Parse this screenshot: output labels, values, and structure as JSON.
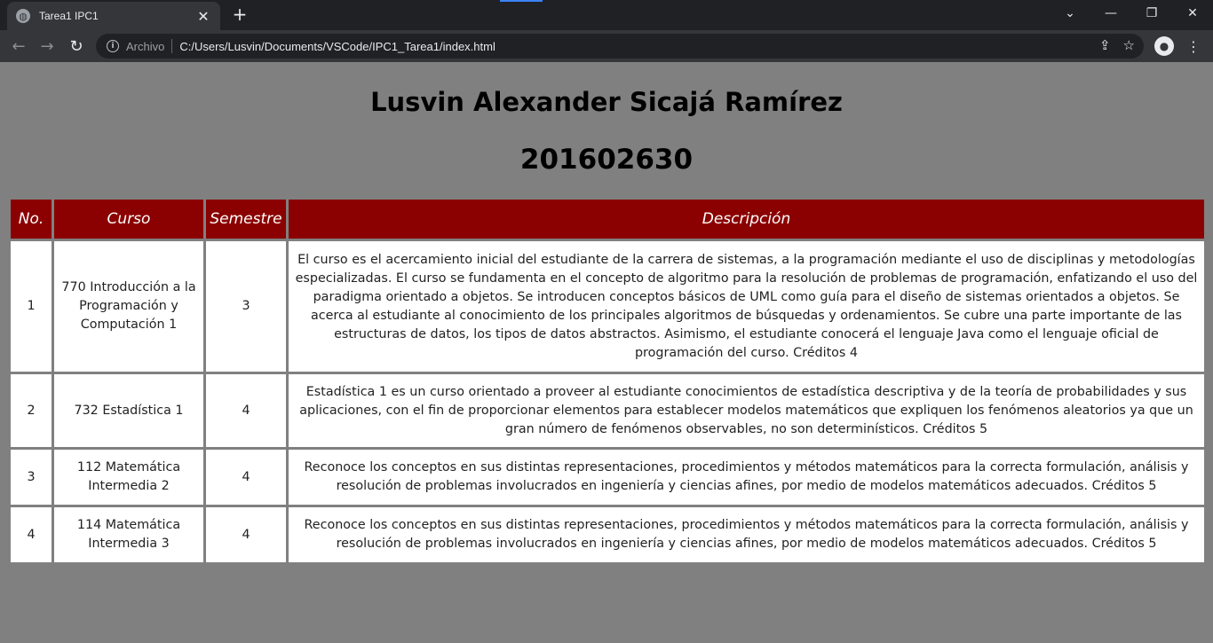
{
  "browser": {
    "tab_title": "Tarea1 IPC1",
    "tab_close": "✕",
    "new_tab": "+",
    "address_label": "Archivo",
    "url": "C:/Users/Lusvin/Documents/VSCode/IPC1_Tarea1/index.html"
  },
  "page": {
    "name": "Lusvin Alexander Sicajá Ramírez",
    "carnet": "201602630"
  },
  "table": {
    "headers": [
      "No.",
      "Curso",
      "Semestre",
      "Descripción"
    ],
    "rows": [
      {
        "no": "1",
        "curso": "770 Introducción a la Programación y Computación 1",
        "semestre": "3",
        "descripcion": "El curso es el acercamiento inicial del estudiante de la carrera de sistemas, a la programación mediante el uso de disciplinas y metodologías especializadas. El curso se fundamenta en el concepto de algoritmo para la resolución de problemas de programación, enfatizando el uso del paradigma orientado a objetos. Se introducen conceptos básicos de UML como guía para el diseño de sistemas orientados a objetos. Se acerca al estudiante al conocimiento de los principales algoritmos de búsquedas y ordenamientos. Se cubre una parte importante de las estructuras de datos, los tipos de datos abstractos. Asimismo, el estudiante conocerá el lenguaje Java como el lenguaje oficial de programación del curso. Créditos 4"
      },
      {
        "no": "2",
        "curso": "732 Estadística 1",
        "semestre": "4",
        "descripcion": "Estadística 1 es un curso orientado a proveer al estudiante conocimientos de estadística descriptiva y de la teoría de probabilidades y sus aplicaciones, con el fin de proporcionar elementos para establecer modelos matemáticos que expliquen los fenómenos aleatorios ya que un gran número de fenómenos observables, no son determinísticos. Créditos 5"
      },
      {
        "no": "3",
        "curso": "112 Matemática Intermedia 2",
        "semestre": "4",
        "descripcion": "Reconoce los conceptos en sus distintas representaciones, procedimientos y métodos matemáticos para la correcta formulación, análisis y resolución de problemas involucrados en ingeniería y ciencias afines, por medio de modelos matemáticos adecuados. Créditos 5"
      },
      {
        "no": "4",
        "curso": "114 Matemática Intermedia 3",
        "semestre": "4",
        "descripcion": "Reconoce los conceptos en sus distintas representaciones, procedimientos y métodos matemáticos para la correcta formulación, análisis y resolución de problemas involucrados en ingeniería y ciencias afines, por medio de modelos matemáticos adecuados. Créditos 5"
      }
    ]
  }
}
